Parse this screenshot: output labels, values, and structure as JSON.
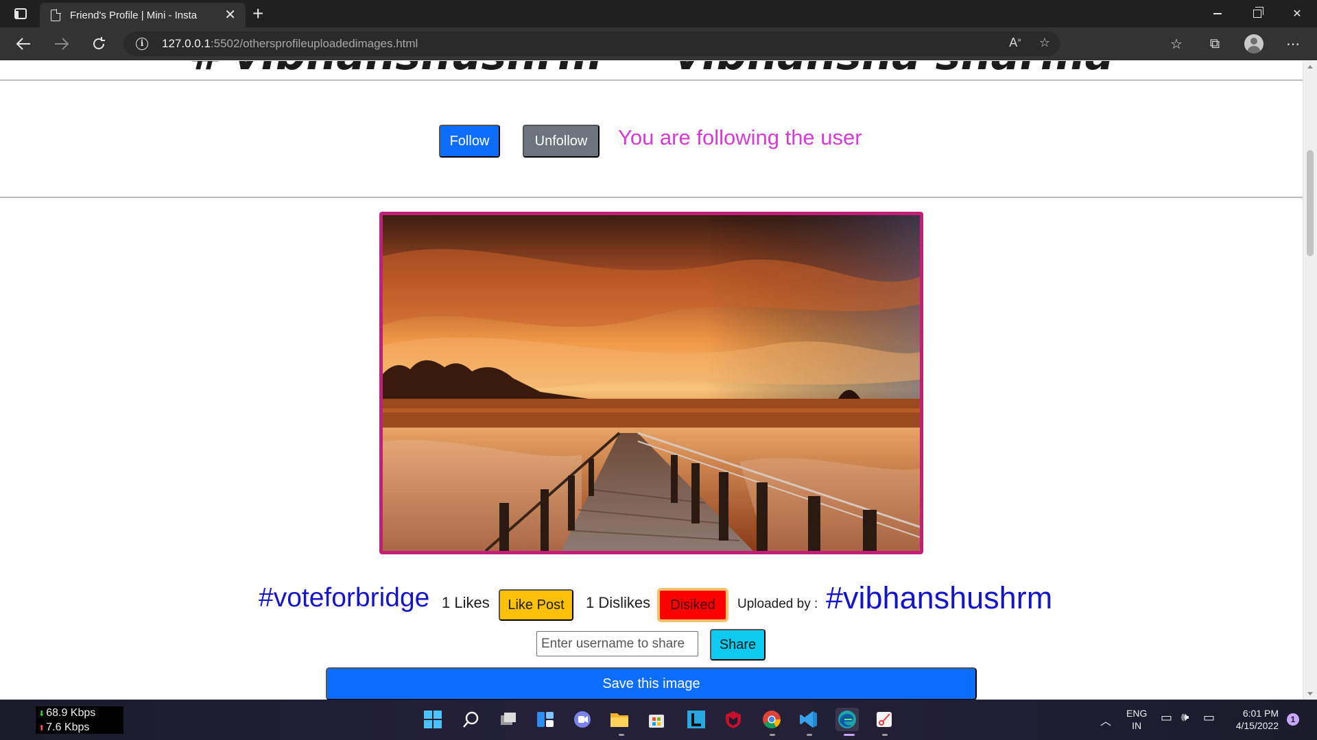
{
  "browser": {
    "tab_title": "Friend's Profile | Mini - Insta",
    "url_host": "127.0.0.1",
    "url_path": ":5502/othersprofileuploadedimages.html"
  },
  "page": {
    "heading": "# vibhanshushrm — vibhansha sharma",
    "follow_button": "Follow",
    "unfollow_button": "Unfollow",
    "follow_status": "You are following the user",
    "post": {
      "hashtag": "#voteforbridge",
      "likes_text": "1 Likes",
      "like_button": "Like Post",
      "dislikes_text": "1 Dislikes",
      "dislike_button": "Disiked",
      "uploaded_by_label": "Uploaded by :",
      "uploader": "#vibhanshushrm",
      "share_placeholder": "Enter username to share",
      "share_button": "Share",
      "save_button": "Save this image"
    }
  },
  "taskbar": {
    "net_down": "68.9 Kbps",
    "net_up": "7.6 Kbps",
    "lang_line1": "ENG",
    "lang_line2": "IN",
    "time": "6:01 PM",
    "date": "4/15/2022",
    "notification_count": "1"
  },
  "colors": {
    "primary": "#0d6efd",
    "secondary": "#6c757d",
    "warning": "#ffc107",
    "danger": "#ff0000",
    "info": "#0dcaf0",
    "status_magenta": "#d63ad6",
    "hashtag_blue": "#1515c8",
    "frame_border": "#c21f78"
  }
}
